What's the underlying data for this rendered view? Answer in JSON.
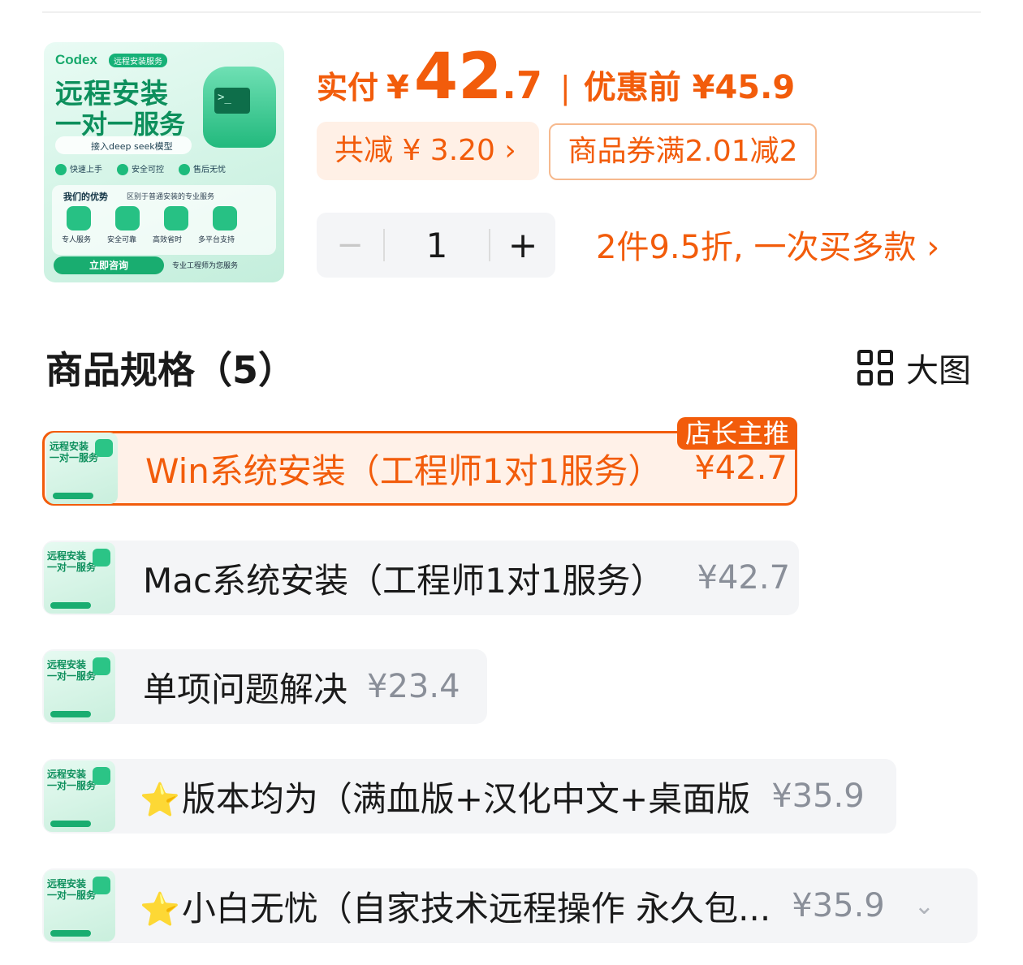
{
  "thumbnail": {
    "brand": "Codex",
    "tag": "远程安装服务",
    "title_line1": "远程安装",
    "title_line2": "一对一服务",
    "terminal_glyph": ">_",
    "model_note": "接入deep seek模型",
    "features": [
      "快速上手",
      "安全可控",
      "售后无忧"
    ],
    "advantages_title": "我们的优势",
    "advantages_sub": "区别于普通安装的专业服务",
    "advantage_items": [
      "专人服务",
      "安全可靠",
      "高效省时",
      "多平台支持"
    ],
    "cta": "立即咨询",
    "cta_note": "专业工程师为您服务"
  },
  "price": {
    "label": "实付",
    "currency": "¥",
    "integer": "42",
    "decimal": ".7",
    "separator": "|",
    "before_label": "优惠前 ¥45.9"
  },
  "discount": {
    "text": "共减 ¥ 3.20 ›"
  },
  "coupon": {
    "text": "商品券满2.01减2"
  },
  "quantity": {
    "minus": "−",
    "value": "1",
    "plus": "+"
  },
  "promo": {
    "text": "2件9.5折, 一次买多款 ›"
  },
  "spec_section": {
    "title": "商品规格（5）",
    "view_label": "大图"
  },
  "options": [
    {
      "name": "Win系统安装（工程师1对1服务）",
      "price": "¥42.7",
      "badge": "店长主推",
      "selected": true
    },
    {
      "name": "Mac系统安装（工程师1对1服务）",
      "price": "¥42.7"
    },
    {
      "name": "单项问题解决",
      "price": "¥23.4"
    },
    {
      "name": "版本均为（满血版+汉化中文+桌面版",
      "price": "¥35.9",
      "star": "⭐"
    },
    {
      "name": "小白无忧（自家技术远程操作 永久包...",
      "price": "¥35.9",
      "star": "⭐",
      "chevron": "⌄"
    }
  ],
  "colors": {
    "accent": "#f25c0b",
    "brand_green": "#19ad70",
    "muted": "#8a8f99"
  }
}
